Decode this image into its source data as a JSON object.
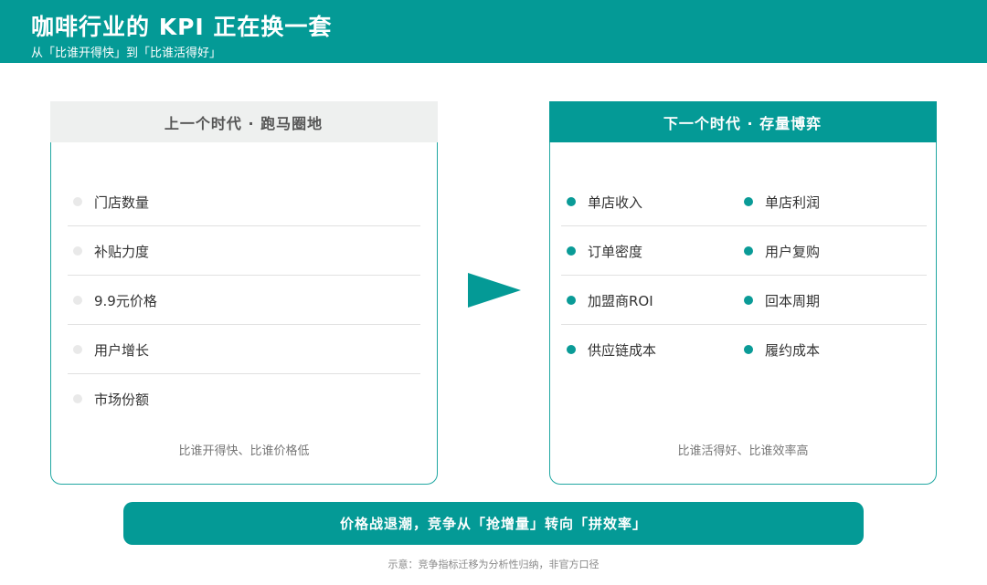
{
  "header": {
    "title": "咖啡行业的 KPI 正在换一套",
    "subtitle": "从「比谁开得快」到「比谁活得好」"
  },
  "left_panel": {
    "title": "上一个时代 ·  跑马圈地",
    "items": [
      "门店数量",
      "补贴力度",
      "9.9元价格",
      "用户增长",
      "市场份额"
    ],
    "footer": "比谁开得快、比谁价格低"
  },
  "right_panel": {
    "title": "下一个时代 ·  存量博弈",
    "rows": [
      [
        "单店收入",
        "单店利润"
      ],
      [
        "订单密度",
        "用户复购"
      ],
      [
        "加盟商ROI",
        "回本周期"
      ],
      [
        "供应链成本",
        "履约成本"
      ]
    ],
    "footer": "比谁活得好、比谁效率高"
  },
  "banner": "价格战退潮，竞争从「抢增量」转向「拼效率」",
  "note": "示意：竞争指标迁移为分析性归纳，非官方口径",
  "colors": {
    "brand_teal": "#049a96",
    "muted_grey": "#eef0ef",
    "dot_grey": "#e9e9e9"
  }
}
